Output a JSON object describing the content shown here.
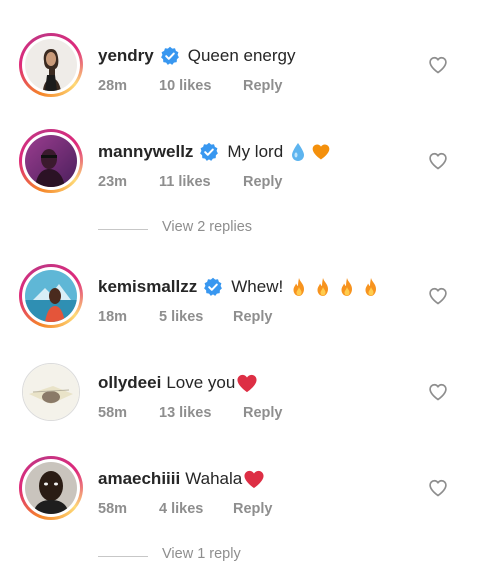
{
  "colors": {
    "text": "#262626",
    "meta": "#8e8e8e",
    "verified": "#3897f0",
    "story_ring": "#dd2a7b",
    "heart_emoji": "#e0245e",
    "fire": "#f7931e"
  },
  "comments": [
    {
      "username": "yendry",
      "verified": true,
      "text": "Queen energy",
      "time": "28m",
      "likes": "10 likes",
      "reply": "Reply",
      "emojis": []
    },
    {
      "username": "mannywellz",
      "verified": true,
      "text": "My lord",
      "time": "23m",
      "likes": "11 likes",
      "reply": "Reply",
      "emojis": [
        "droplet-emoji",
        "orange-heart-emoji"
      ]
    },
    {
      "username": "kemismallzz",
      "verified": true,
      "text": "Whew!",
      "time": "18m",
      "likes": "5 likes",
      "reply": "Reply",
      "emojis": [
        "fire-emoji",
        "fire-emoji",
        "fire-emoji",
        "fire-emoji"
      ]
    },
    {
      "username": "ollydeei",
      "verified": false,
      "text": "Love you",
      "time": "58m",
      "likes": "13 likes",
      "reply": "Reply",
      "emojis": [
        "red-heart-emoji"
      ]
    },
    {
      "username": "amaechiiii",
      "verified": false,
      "text": "Wahala",
      "time": "58m",
      "likes": "4 likes",
      "reply": "Reply",
      "emojis": [
        "red-heart-emoji"
      ]
    }
  ],
  "view_replies": [
    {
      "label": "View 2 replies"
    },
    {
      "label": "View 1 reply"
    }
  ],
  "icons": {
    "like": "heart-outline-icon",
    "verified": "verified-badge-icon"
  }
}
